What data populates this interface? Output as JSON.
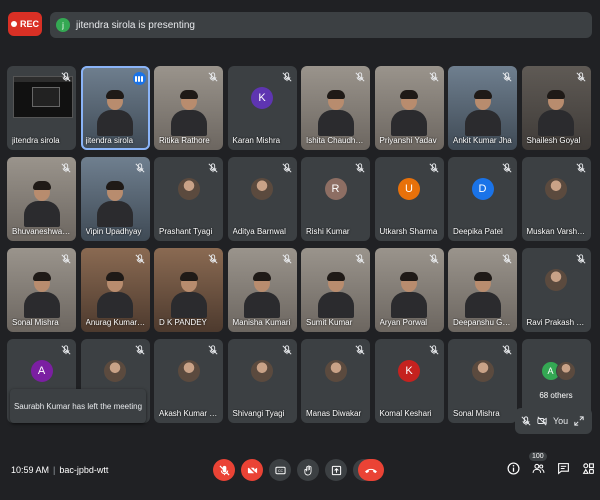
{
  "top": {
    "rec_label": "REC",
    "presenter_initial": "j",
    "presenting_text": "jitendra sirola is presenting"
  },
  "tiles": [
    {
      "name": "jitendra sirola",
      "kind": "screen"
    },
    {
      "name": "jitendra sirola",
      "kind": "photo",
      "style": "cool",
      "active": true,
      "speaking": true
    },
    {
      "name": "Ritika Rathore",
      "kind": "photo",
      "style": "light"
    },
    {
      "name": "Karan Mishra",
      "kind": "letter",
      "letter": "K",
      "color": "#5e35b1"
    },
    {
      "name": "Ishita Chaudhary",
      "kind": "photo",
      "style": "light"
    },
    {
      "name": "Priyanshi Yadav",
      "kind": "photo",
      "style": "light"
    },
    {
      "name": "Ankit Kumar Jha",
      "kind": "photo",
      "style": "cool"
    },
    {
      "name": "Shailesh Goyal",
      "kind": "photo",
      "style": "photo"
    },
    {
      "name": "Bhuvaneshwar ...",
      "kind": "photo",
      "style": "light"
    },
    {
      "name": "Vipin Upadhyay",
      "kind": "photo",
      "style": "cool"
    },
    {
      "name": "Prashant Tyagi",
      "kind": "avatar"
    },
    {
      "name": "Aditya Barnwal",
      "kind": "avatar"
    },
    {
      "name": "Rishi Kumar",
      "kind": "letter",
      "letter": "R",
      "color": "#8d6e63"
    },
    {
      "name": "Utkarsh Sharma",
      "kind": "letter",
      "letter": "U",
      "color": "#e8710a"
    },
    {
      "name": "Deepika Patel",
      "kind": "letter",
      "letter": "D",
      "color": "#1a73e8"
    },
    {
      "name": "Muskan Varshney",
      "kind": "avatar"
    },
    {
      "name": "Sonal Mishra",
      "kind": "photo",
      "style": "light"
    },
    {
      "name": "Anurag Kumar ...",
      "kind": "photo",
      "style": "warm"
    },
    {
      "name": "D K PANDEY",
      "kind": "photo",
      "style": "warm"
    },
    {
      "name": "Manisha Kumari",
      "kind": "photo",
      "style": "light"
    },
    {
      "name": "Sumit Kumar",
      "kind": "photo",
      "style": "light"
    },
    {
      "name": "Aryan Porwal",
      "kind": "photo",
      "style": "light"
    },
    {
      "name": "Deepanshu Gu...",
      "kind": "photo",
      "style": "light"
    },
    {
      "name": "Ravi Prakash Sin...",
      "kind": "avatar"
    },
    {
      "name": "",
      "kind": "letter",
      "letter": "A",
      "color": "#7b1fa2"
    },
    {
      "name": "",
      "kind": "avatar"
    },
    {
      "name": "Akash Kumar Sin...",
      "kind": "avatar"
    },
    {
      "name": "Shivangi Tyagi",
      "kind": "avatar"
    },
    {
      "name": "Manas Diwakar",
      "kind": "avatar"
    },
    {
      "name": "Komal Keshari",
      "kind": "letter",
      "letter": "K",
      "color": "#c5221f"
    },
    {
      "name": "Sonal Mishra",
      "kind": "avatar"
    },
    {
      "name": "68 others",
      "kind": "others",
      "letter": "A",
      "color": "#34a853"
    }
  ],
  "toast": {
    "text": "Saurabh Kumar has left the meeting"
  },
  "self": {
    "label": "You"
  },
  "bottom": {
    "time": "10:59 AM",
    "meeting_code": "bac-jpbd-wtt",
    "people_count": "100"
  },
  "colors": {
    "background": "#202124",
    "tile": "#3c4043",
    "danger": "#ea4335",
    "accent": "#8ab4f8"
  }
}
